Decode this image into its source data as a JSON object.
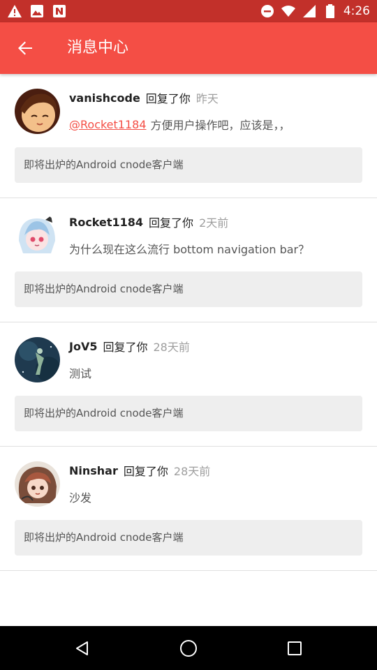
{
  "status_bar": {
    "time": "4:26",
    "icons_left": [
      "warning-icon",
      "image-icon",
      "n-icon"
    ],
    "icons_right": [
      "dnd-icon",
      "wifi-icon",
      "signal-icon",
      "battery-icon"
    ]
  },
  "app_bar": {
    "title": "消息中心",
    "back_icon": "arrow-left-icon",
    "color": "#f44e45"
  },
  "messages": [
    {
      "username": "vanishcode",
      "action": "回复了你",
      "time": "昨天",
      "mention": "@Rocket1184",
      "content": "方便用户操作吧，应该是，，",
      "topic": "即将出炉的Android cnode客户端"
    },
    {
      "username": "Rocket1184",
      "action": "回复了你",
      "time": "2天前",
      "mention": "",
      "content": "为什么现在这么流行 bottom navigation bar？",
      "topic": "即将出炉的Android cnode客户端"
    },
    {
      "username": "JoV5",
      "action": "回复了你",
      "time": "28天前",
      "mention": "",
      "content": "测试",
      "topic": "即将出炉的Android cnode客户端"
    },
    {
      "username": "Ninshar",
      "action": "回复了你",
      "time": "28天前",
      "mention": "",
      "content": "沙发",
      "topic": "即将出炉的Android cnode客户端"
    }
  ],
  "nav_bar": {
    "icons": [
      "back-triangle-icon",
      "home-circle-icon",
      "recents-square-icon"
    ]
  }
}
